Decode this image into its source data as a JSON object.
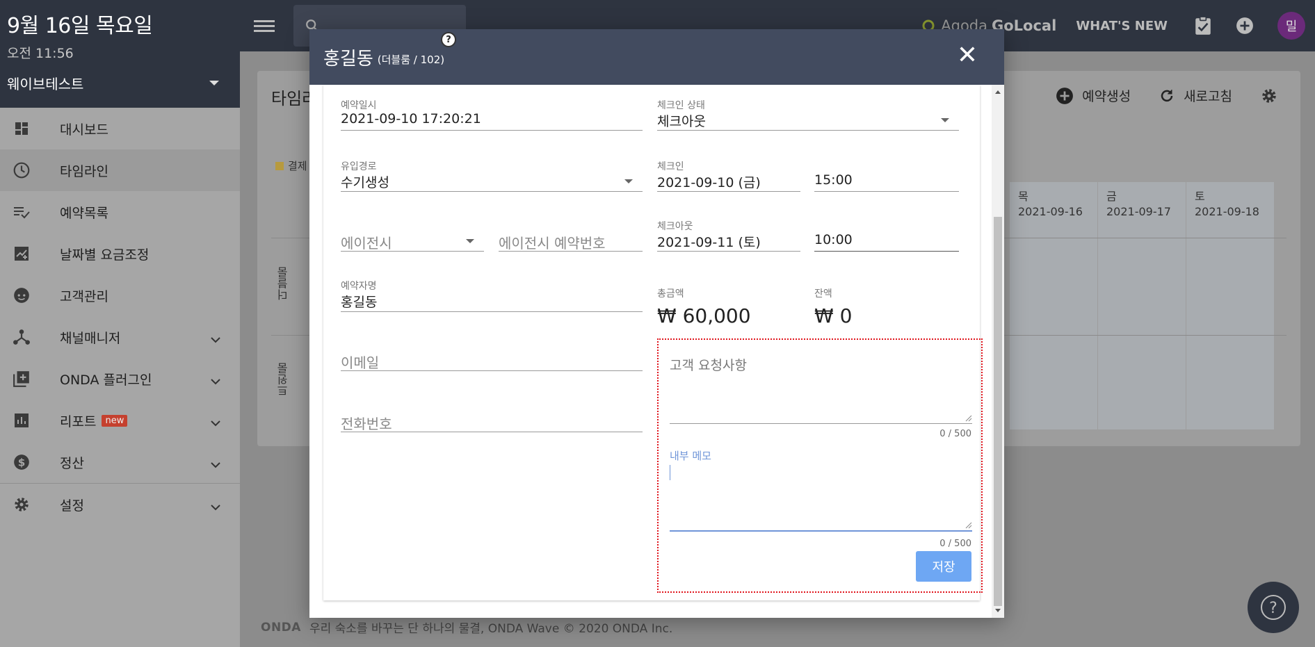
{
  "sidebar": {
    "date": "9월 16일 목요일",
    "time": "오전 11:56",
    "property": "웨이브테스트",
    "items": [
      {
        "label": "대시보드",
        "icon": "dashboard-icon"
      },
      {
        "label": "타임라인",
        "icon": "clock-icon"
      },
      {
        "label": "예약목록",
        "icon": "list-check-icon"
      },
      {
        "label": "날짜별 요금조정",
        "icon": "chart-edit-icon"
      },
      {
        "label": "고객관리",
        "icon": "face-icon"
      },
      {
        "label": "채널매니저",
        "icon": "hub-icon"
      },
      {
        "label": "ONDA 플러그인",
        "icon": "add-box-icon"
      },
      {
        "label": "리포트",
        "icon": "bar-chart-icon",
        "badge": "new"
      },
      {
        "label": "정산",
        "icon": "dollar-icon"
      },
      {
        "label": "설정",
        "icon": "gear-icon"
      }
    ]
  },
  "topbar": {
    "agoda_prefix": "Agoda",
    "agoda_brand": "GoLocal",
    "whats_new": "WHAT'S NEW",
    "avatar_initial": "밀"
  },
  "background": {
    "title": "타임라",
    "create_label": "예약생성",
    "refresh_label": "새로고침",
    "legend_label": "결제",
    "row_labels": [
      "더블룸",
      "트윈룸"
    ],
    "days": [
      {
        "dow": "목",
        "date": "2021-09-16"
      },
      {
        "dow": "금",
        "date": "2021-09-17"
      },
      {
        "dow": "토",
        "date": "2021-09-18"
      }
    ],
    "footer_logo": "ONDA",
    "footer_text": "우리 숙소를 바꾸는 단 하나의 물결, ONDA Wave © 2020 ONDA Inc."
  },
  "modal": {
    "guest_name": "홍길동",
    "room_info": "(더블룸 / 102)",
    "help": "?",
    "close": "✕",
    "booking_datetime_label": "예약일시",
    "booking_datetime": "2021-09-10 17:20:21",
    "checkin_status_label": "체크인 상태",
    "checkin_status": "체크아웃",
    "channel_label": "유입경로",
    "channel": "수기생성",
    "checkin_label": "체크인",
    "checkin_date": "2021-09-10 (금)",
    "checkin_time": "15:00",
    "agency_placeholder": "에이전시",
    "agency_no_placeholder": "에이전시 예약번호",
    "checkout_label": "체크아웃",
    "checkout_date": "2021-09-11 (토)",
    "checkout_time": "10:00",
    "booker_label": "예약자명",
    "booker": "홍길동",
    "total_label": "총금액",
    "total": "₩ 60,000",
    "balance_label": "잔액",
    "balance": "₩ 0",
    "email_placeholder": "이메일",
    "phone_placeholder": "전화번호",
    "request_placeholder": "고객 요청사항",
    "request_counter": "0 / 500",
    "memo_label": "내부 메모",
    "memo_counter": "0 / 500",
    "save_label": "저장"
  }
}
